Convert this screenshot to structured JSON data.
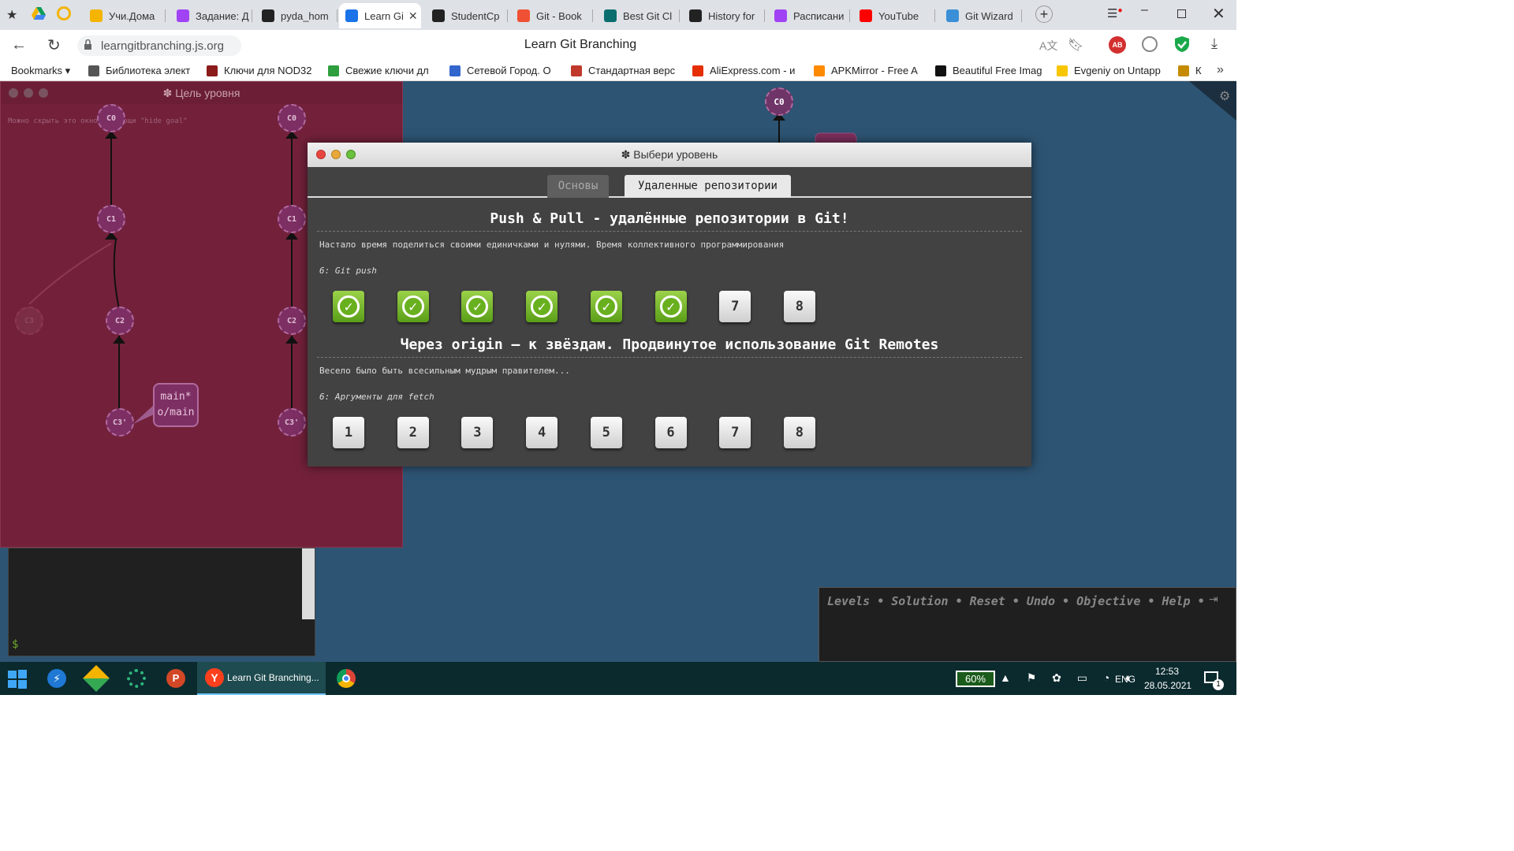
{
  "browser": {
    "tabs": [
      {
        "title": "Учи.Дома",
        "color": "#f4b400"
      },
      {
        "title": "Задание: Д",
        "color": "#a142f4"
      },
      {
        "title": "pyda_hom",
        "color": "#222"
      },
      {
        "title": "Learn Gi",
        "color": "#1a73e8",
        "active": true
      },
      {
        "title": "StudentCp",
        "color": "#222"
      },
      {
        "title": "Git - Book",
        "color": "#f05033"
      },
      {
        "title": "Best Git Cl",
        "color": "#0a6e6e"
      },
      {
        "title": "History for",
        "color": "#222"
      },
      {
        "title": "Расписани",
        "color": "#a142f4"
      },
      {
        "title": "YouTube",
        "color": "#ff0000"
      },
      {
        "title": "Git Wizard",
        "color": "#3a8fd6"
      }
    ],
    "url": "learngitbranching.js.org",
    "page_title": "Learn Git Branching",
    "bookmarks_label": "Bookmarks ▾",
    "bookmarks": [
      {
        "label": "Библиотека элект",
        "color": "#555"
      },
      {
        "label": "Ключи для NOD32",
        "color": "#8b1a1a"
      },
      {
        "label": "Свежие ключи дл",
        "color": "#2e9e3e"
      },
      {
        "label": "Сетевой Город. О",
        "color": "#3366cc"
      },
      {
        "label": "Стандартная верс",
        "color": "#c0392b"
      },
      {
        "label": "AliExpress.com - и",
        "color": "#e62e04"
      },
      {
        "label": "APKMirror - Free A",
        "color": "#ff8a00"
      },
      {
        "label": "Beautiful Free Imag",
        "color": "#111"
      },
      {
        "label": "Evgeniy on Untapp",
        "color": "#f7c600"
      },
      {
        "label": "К",
        "color": "#c48a00"
      }
    ]
  },
  "goal_window": {
    "title": "✽ Цель уровня",
    "hint": "Можно скрыть это окно с помощи \"hide goal\"",
    "commits": [
      "C0",
      "C1",
      "C2",
      "C3'",
      "C3"
    ],
    "branch_labels": [
      "main*",
      "o/main"
    ]
  },
  "background_commit": "C0",
  "modal": {
    "title": "✽ Выбери уровень",
    "tabs": [
      "Основы",
      "Удаленные репозитории"
    ],
    "sections": [
      {
        "heading": "Push & Pull - удалённые репозитории в Git!",
        "description": "Настало время поделиться своими единичками и нулями. Время коллективного программирования",
        "current": "6: Git push",
        "levels": [
          {
            "label": "1",
            "done": true
          },
          {
            "label": "2",
            "done": true
          },
          {
            "label": "3",
            "done": true
          },
          {
            "label": "4",
            "done": true
          },
          {
            "label": "5",
            "done": true
          },
          {
            "label": "6",
            "done": true
          },
          {
            "label": "7",
            "done": false
          },
          {
            "label": "8",
            "done": false
          }
        ]
      },
      {
        "heading": "Через origin – к звёздам. Продвинутое использование Git Remotes",
        "description": "Весело было быть всесильным мудрым правителем...",
        "current": "6: Аргументы для fetch",
        "levels": [
          {
            "label": "1",
            "done": false
          },
          {
            "label": "2",
            "done": false
          },
          {
            "label": "3",
            "done": false
          },
          {
            "label": "4",
            "done": false
          },
          {
            "label": "5",
            "done": false
          },
          {
            "label": "6",
            "done": false
          },
          {
            "label": "7",
            "done": false
          },
          {
            "label": "8",
            "done": false
          }
        ]
      }
    ]
  },
  "commands": [
    "Levels",
    "Solution",
    "Reset",
    "Undo",
    "Objective",
    "Help"
  ],
  "terminal_prompt": "$",
  "taskbar": {
    "active_app": "Learn Git Branching...",
    "battery": "60%",
    "language": "ENG",
    "time": "12:53",
    "date": "28.05.2021",
    "notifications": "1"
  }
}
